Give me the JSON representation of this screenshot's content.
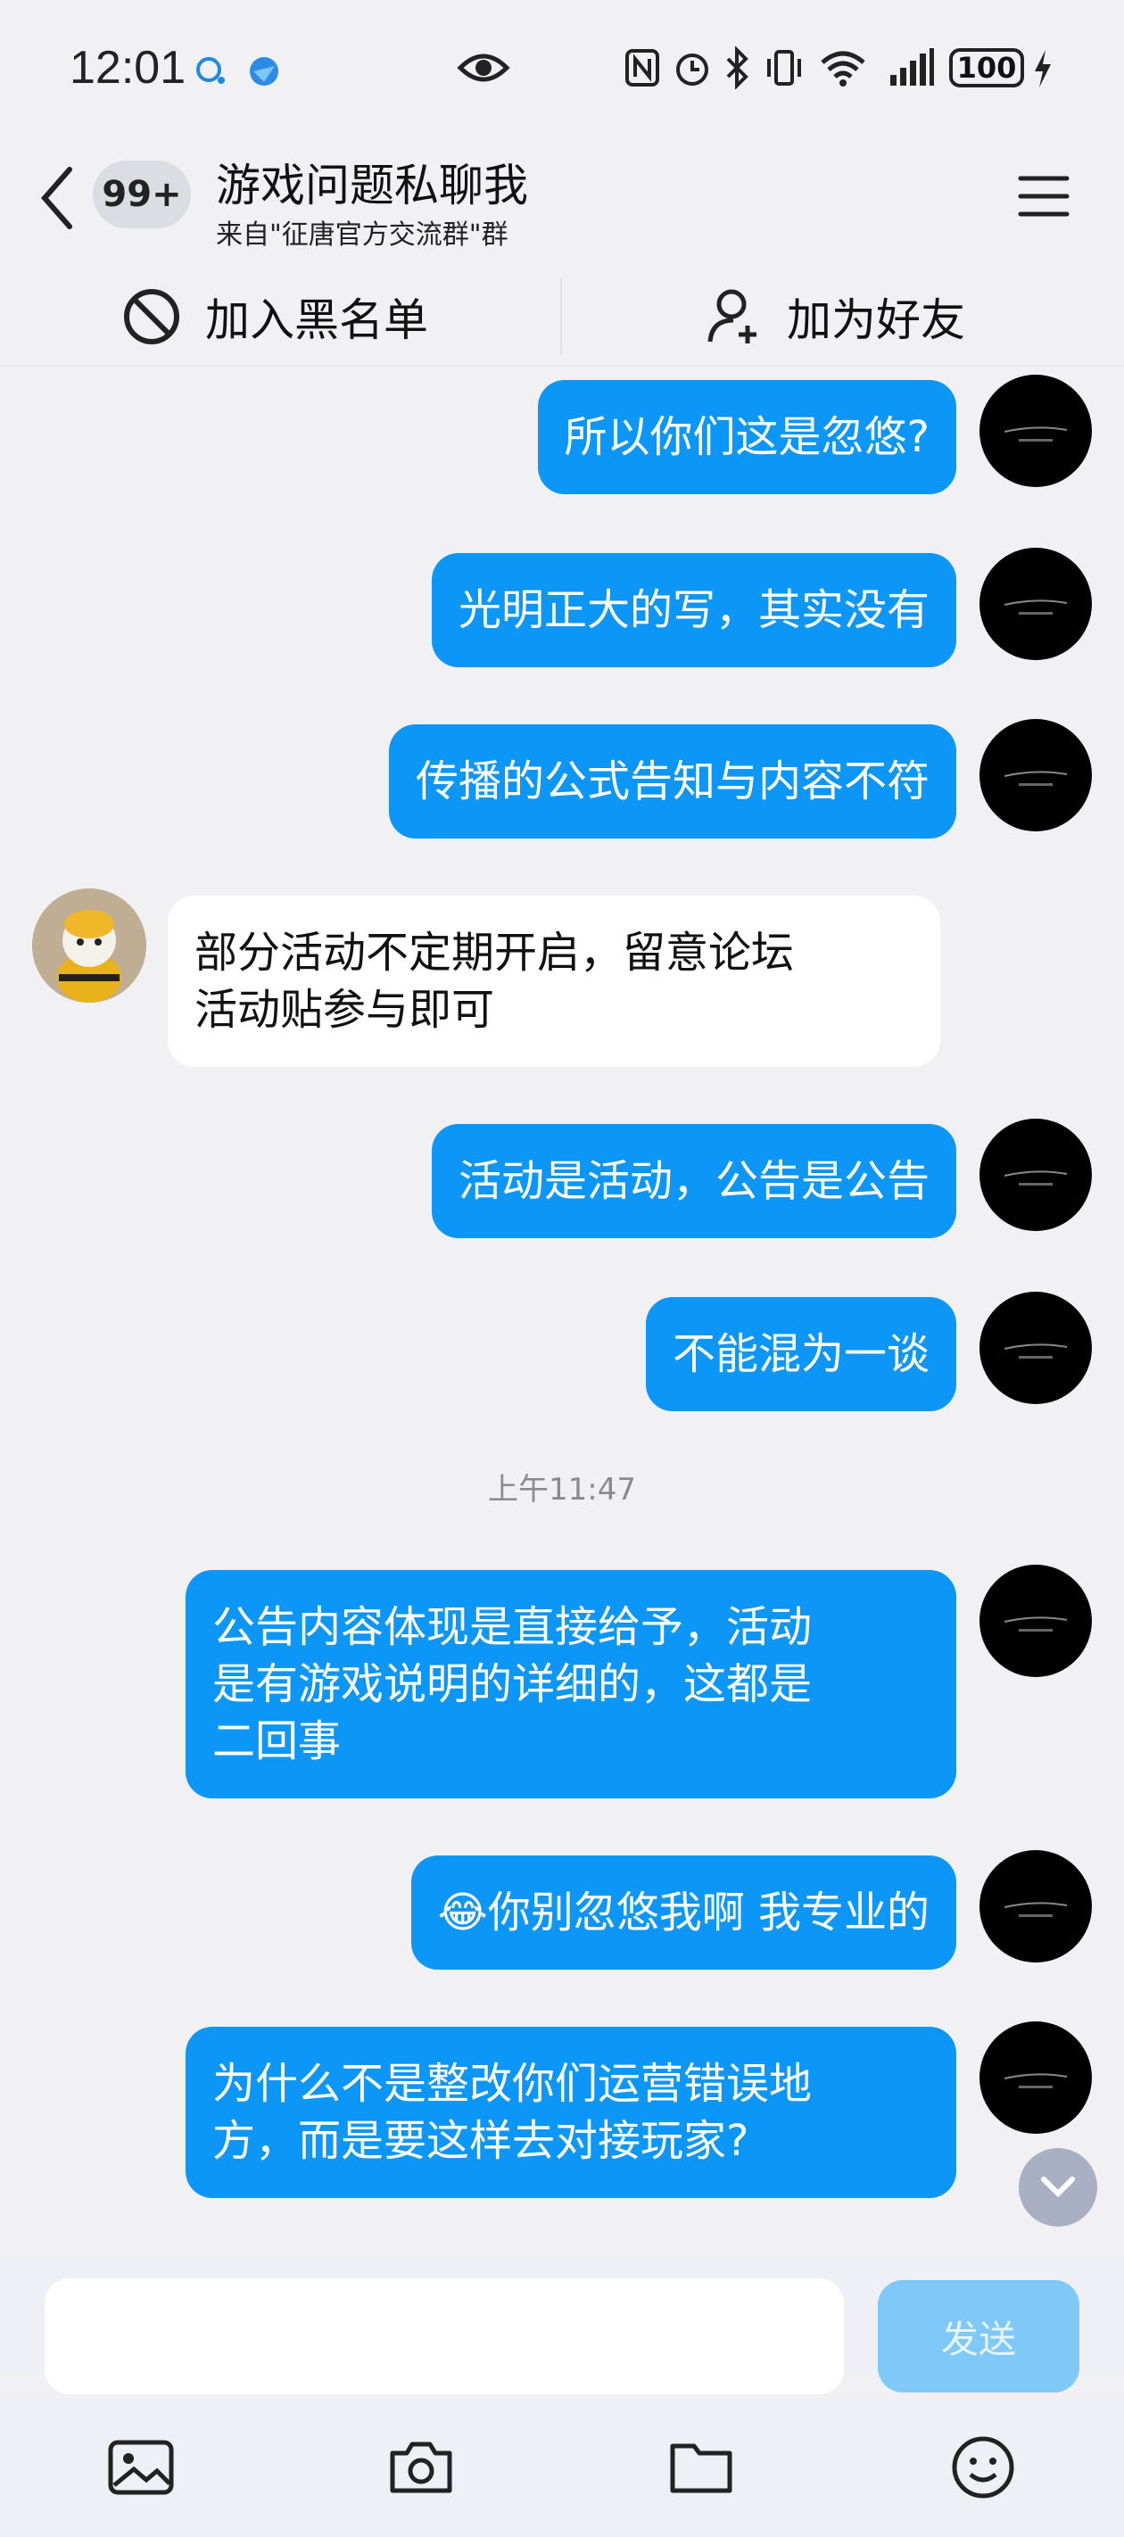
{
  "status_bar": {
    "time": "12:01",
    "battery": "100",
    "icons": [
      "qq-notify-icon",
      "browser-icon",
      "eye-icon",
      "nfc-icon",
      "alarm-icon",
      "bluetooth-icon",
      "vibrate-icon",
      "wifi-icon",
      "signal-icon",
      "battery-icon",
      "charging-icon"
    ]
  },
  "header": {
    "unread_badge": "99+",
    "title": "游戏问题私聊我",
    "subtitle": "来自\"征唐官方交流群\"群"
  },
  "actions": {
    "blacklist_label": "加入黑名单",
    "add_friend_label": "加为好友"
  },
  "messages": [
    {
      "side": "out",
      "text": "所以你们这是忽悠?"
    },
    {
      "side": "out",
      "text": "光明正大的写，其实没有"
    },
    {
      "side": "out",
      "text": "传播的公式告知与内容不符"
    },
    {
      "side": "in",
      "text": "部分活动不定期开启，留意论坛\n活动贴参与即可"
    },
    {
      "side": "out",
      "text": "活动是活动，公告是公告"
    },
    {
      "side": "out",
      "text": "不能混为一谈"
    },
    {
      "side": "out",
      "text": "公告内容体现是直接给予，活动\n是有游戏说明的详细的，这都是\n二回事"
    },
    {
      "side": "out",
      "text": "😂你别忽悠我啊 我专业的"
    },
    {
      "side": "out",
      "text": "为什么不是整改你们运营错误地\n方，而是要这样去对接玩家?"
    }
  ],
  "timestamp": "上午11:47",
  "input": {
    "value": "",
    "send_label": "发送"
  },
  "toolbar": [
    "image-icon",
    "camera-icon",
    "folder-icon",
    "emoji-icon"
  ],
  "colors": {
    "outgoing_bubble": "#0b96f8",
    "incoming_bubble": "#ffffff",
    "background": "#f1f1f4",
    "send_button": "#7fc9f8"
  }
}
